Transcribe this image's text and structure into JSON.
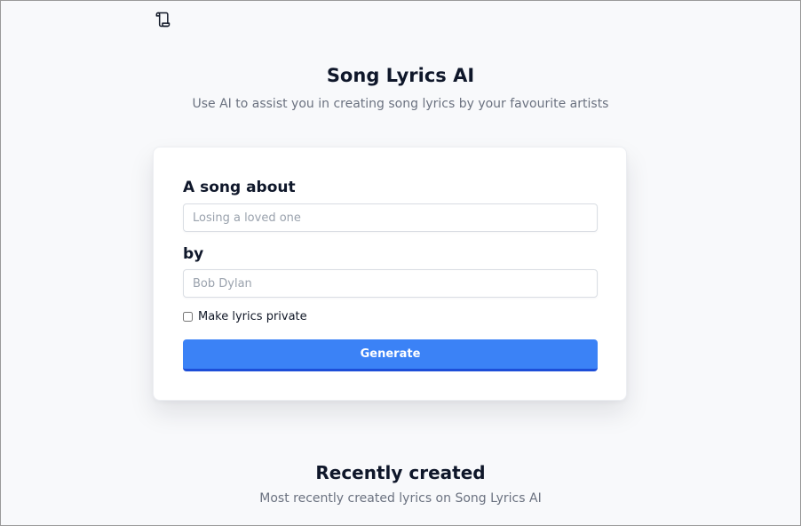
{
  "header": {
    "logo_icon": "scroll-icon",
    "title": "Song Lyrics AI",
    "subtitle": "Use AI to assist you in creating song lyrics by your favourite artists"
  },
  "form": {
    "topic_label": "A song about",
    "topic_placeholder": "Losing a loved one",
    "artist_label": "by",
    "artist_placeholder": "Bob Dylan",
    "private_label": "Make lyrics private",
    "private_checked": false,
    "generate_label": "Generate"
  },
  "recent": {
    "title": "Recently created",
    "subtitle": "Most recently created lyrics on Song Lyrics AI"
  },
  "colors": {
    "page_background": "#f8f9fb",
    "accent": "#3b82f6",
    "accent_dark": "#1d4ed8",
    "text": "#0f172a",
    "muted": "#6b7280"
  }
}
